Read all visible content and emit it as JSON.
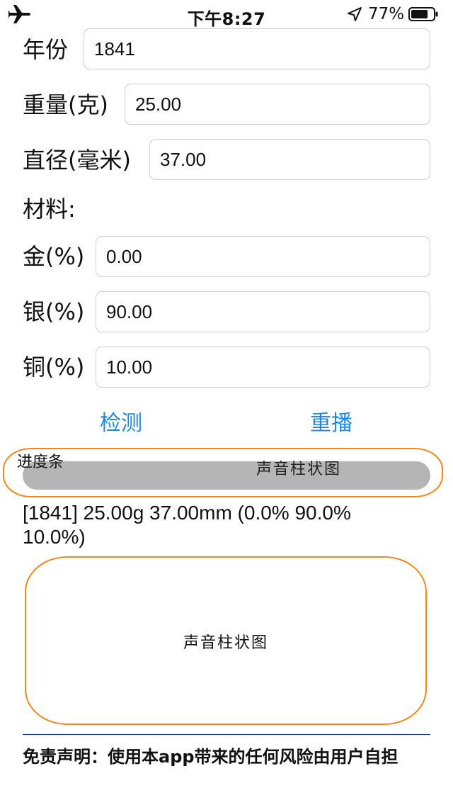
{
  "status_bar": {
    "time": "下午8:27",
    "battery_percent": "77%",
    "battery_level": 0.77,
    "airplane_icon": "airplane-icon",
    "location_icon": "location-arrow-icon",
    "battery_icon": "battery-icon"
  },
  "form": {
    "year_label": "年份",
    "year_value": "1841",
    "weight_label": "重量(克)",
    "weight_value": "25.00",
    "diameter_label": "直径(毫米)",
    "diameter_value": "37.00",
    "material_label": "材料:",
    "gold_label": "金(%)",
    "gold_value": "0.00",
    "silver_label": "银(%)",
    "silver_value": "90.00",
    "copper_label": "铜(%)",
    "copper_value": "10.00"
  },
  "actions": {
    "detect_label": "检测",
    "replay_label": "重播"
  },
  "annotations": {
    "progress_label": "进度条",
    "top_chart_label": "声音柱状图",
    "chart_label": "声音柱状图"
  },
  "progress": {
    "value": 0
  },
  "summary": {
    "text": "[1841] 25.00g 37.00mm (0.0% 90.0% 10.0%)"
  },
  "disclaimer": {
    "text": "免责声明：使用本app带来的任何风险由用户自担"
  },
  "colors": {
    "accent": "#1e88e5",
    "annotation": "#f0891c",
    "progress_track": "#b5b5b5",
    "divider": "#1a2ea8"
  }
}
